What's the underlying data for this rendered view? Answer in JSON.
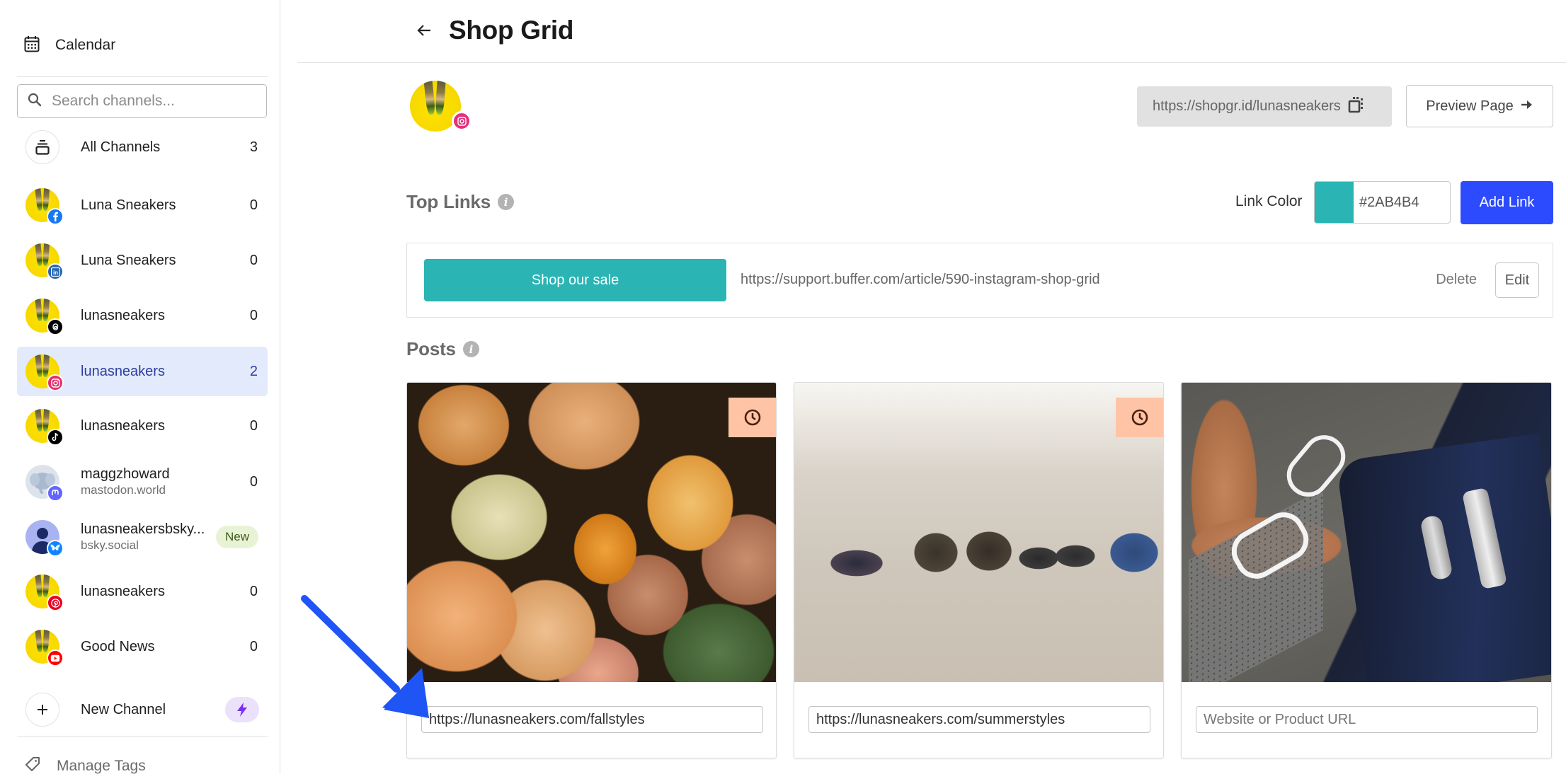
{
  "sidebar": {
    "calendar_label": "Calendar",
    "search_placeholder": "Search channels...",
    "all_channels": {
      "label": "All Channels",
      "count": "3"
    },
    "channels": [
      {
        "name": "Luna Sneakers",
        "network": "facebook",
        "network_color": "#1877F2",
        "count": "0",
        "selected": false
      },
      {
        "name": "Luna Sneakers",
        "network": "linkedin",
        "network_color": "#2867B2",
        "count": "0",
        "selected": false
      },
      {
        "name": "lunasneakers",
        "network": "threads",
        "network_color": "#000000",
        "count": "0",
        "selected": false
      },
      {
        "name": "lunasneakers",
        "network": "instagram",
        "network_color": "#E1306C",
        "count": "2",
        "selected": true
      },
      {
        "name": "lunasneakers",
        "network": "tiktok",
        "network_color": "#000000",
        "count": "0",
        "selected": false
      },
      {
        "name": "maggzhoward",
        "subtitle": "mastodon.world",
        "network": "mastodon",
        "network_color": "#6364FF",
        "count": "0",
        "selected": false
      },
      {
        "name": "lunasneakersbsky...",
        "subtitle": "bsky.social",
        "network": "bluesky",
        "network_color": "#1185FE",
        "badge": "New",
        "selected": false
      },
      {
        "name": "lunasneakers",
        "network": "pinterest",
        "network_color": "#E60023",
        "count": "0",
        "selected": false
      },
      {
        "name": "Good News",
        "network": "youtube",
        "network_color": "#FF0000",
        "count": "0",
        "selected": false
      }
    ],
    "new_channel_label": "New Channel",
    "manage_tags_label": "Manage Tags"
  },
  "header": {
    "title": "Shop Grid",
    "back_icon": "arrow-left-icon"
  },
  "profile": {
    "network": "instagram",
    "shop_url": "https://shopgr.id/lunasneakers",
    "copy_icon": "copy-icon",
    "preview_label": "Preview Page",
    "preview_icon": "arrow-right-icon"
  },
  "top_links": {
    "title": "Top Links",
    "link_color_label": "Link Color",
    "link_color_hex": "#2AB4B4",
    "add_link_label": "Add Link",
    "links": [
      {
        "label": "Shop our sale",
        "url": "https://support.buffer.com/article/590-instagram-shop-grid",
        "delete_label": "Delete",
        "edit_label": "Edit"
      }
    ]
  },
  "posts": {
    "title": "Posts",
    "url_placeholder": "Website or Product URL",
    "items": [
      {
        "image": "pumpkins",
        "scheduled": true,
        "url": "https://lunasneakers.com/fallstyles"
      },
      {
        "image": "shoes-on-beach",
        "scheduled": true,
        "url": "https://lunasneakers.com/summerstyles"
      },
      {
        "image": "flip-flops-and-suitcase",
        "scheduled": false,
        "url": ""
      }
    ]
  },
  "colors": {
    "primary": "#2C4BFF",
    "link_color": "#2AB4B4",
    "selected_bg": "#E3EAFC",
    "selected_text": "#2C3F9E",
    "scheduled_badge": "#FFC4A6",
    "annotation_arrow": "#1F54F5"
  }
}
